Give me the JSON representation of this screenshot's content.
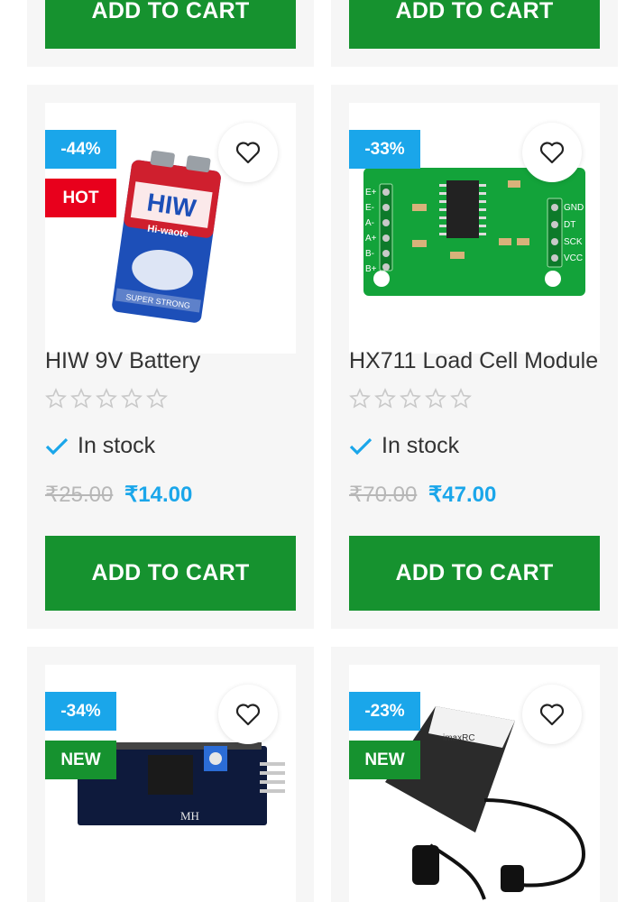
{
  "top_row": {
    "cart_label_left": "ADD TO CART",
    "cart_label_right": "ADD TO CART"
  },
  "products": [
    {
      "discount": "-44%",
      "tag": "HOT",
      "tag_color": "#e8001c",
      "title": "HIW 9V Battery",
      "stock": "In stock",
      "old_price": "₹25.00",
      "new_price": "₹14.00",
      "cart_label": "ADD TO CART",
      "image_brand": "HIW",
      "image_sub": "Hi-waote",
      "image_strip": "SUPER STRONG"
    },
    {
      "discount": "-33%",
      "title": "HX711 Load Cell Module",
      "stock": "In stock",
      "old_price": "₹70.00",
      "new_price": "₹47.00",
      "cart_label": "ADD TO CART",
      "image_pins_left": [
        "E+",
        "E-",
        "A-",
        "A+",
        "B-",
        "B+"
      ],
      "image_pins_right": [
        "GND",
        "DT",
        "SCK",
        "VCC"
      ]
    },
    {
      "discount": "-34%",
      "tag": "NEW",
      "tag_color": "#16922f",
      "image_label": "MH"
    },
    {
      "discount": "-23%",
      "tag": "NEW",
      "tag_color": "#16922f",
      "image_label": "imaxRC"
    }
  ],
  "colors": {
    "accent": "#1aa6ea",
    "button": "#16922f",
    "hot": "#e8001c"
  },
  "icons": [
    "heart-icon",
    "star-icon",
    "check-icon"
  ]
}
